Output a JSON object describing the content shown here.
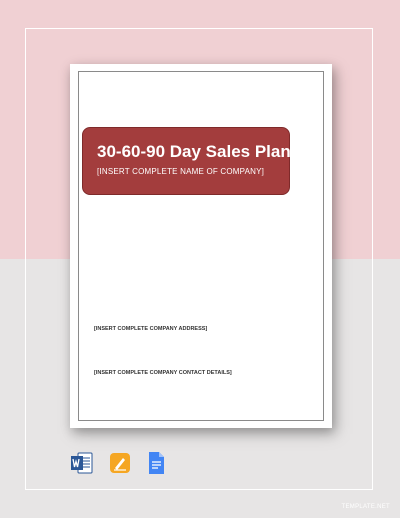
{
  "document": {
    "title": "30-60-90 Day Sales Plan",
    "company_name": "[INSERT COMPLETE NAME OF COMPANY]",
    "company_address": "[INSERT COMPLETE COMPANY ADDRESS]",
    "company_contact": "[INSERT COMPLETE COMPANY CONTACT DETAILS]",
    "title_box_color": "#a33d3d"
  },
  "format_icons": [
    {
      "icon": "word-icon",
      "color": "#2b5797"
    },
    {
      "icon": "pages-icon",
      "color": "#f5a623"
    },
    {
      "icon": "google-docs-icon",
      "color": "#4285f4"
    }
  ],
  "watermark": "TEMPLATE.NET",
  "colors": {
    "top_background": "#f0d0d3",
    "bottom_background": "#e7e5e5"
  }
}
